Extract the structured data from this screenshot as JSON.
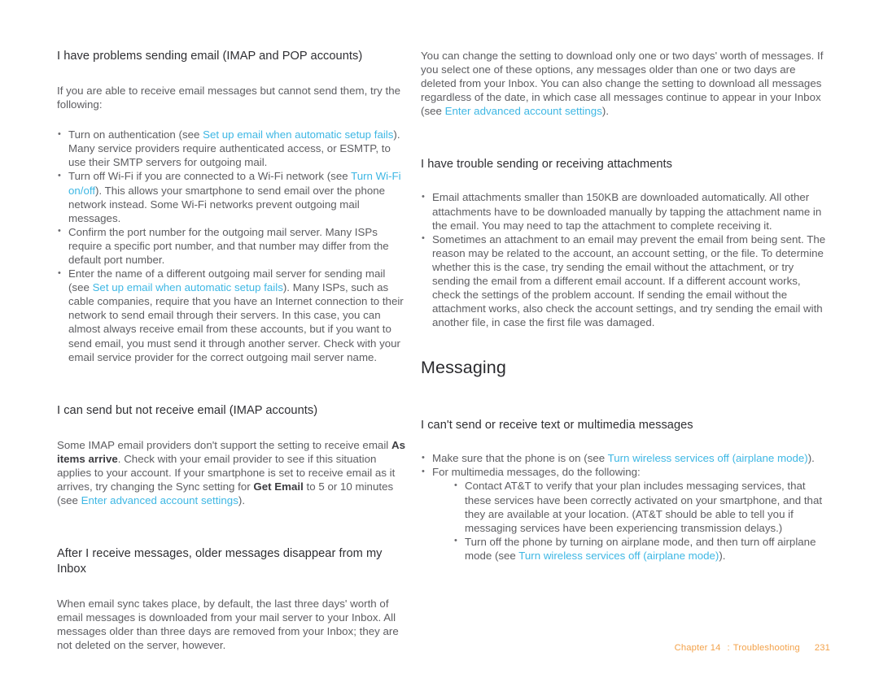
{
  "document": {
    "footer": {
      "chapter_label": "Chapter 14",
      "separator": ":",
      "chapter_title": "Troubleshooting",
      "page_number": "231",
      "color": "#f3a24a"
    },
    "link_color": "#3eb7e4",
    "body_color": "#5d5d61",
    "heading_color": "#2f2f33"
  },
  "left_column": {
    "topic1": {
      "title": "I have problems sending email (IMAP and POP accounts)",
      "intro": "If you are able to receive email messages but cannot send them, try the following:",
      "bullets": [
        {
          "part1": "Turn on authentication (see ",
          "link1": "Set up email when automatic setup fails",
          "part2": "). Many service providers require authenticated access, or ESMTP, to use their SMTP servers for outgoing mail."
        },
        {
          "part1": "Turn off Wi-Fi if you are connected to a Wi-Fi network (see ",
          "link1": "Turn Wi-Fi on/off",
          "part2": "). This allows your smartphone to send email over the phone network instead. Some Wi-Fi networks prevent outgoing mail messages."
        },
        {
          "part1": "Confirm the port number for the outgoing mail server. Many ISPs require a specific port number, and that number may differ from the default port number.",
          "link1": "",
          "part2": ""
        },
        {
          "part1": "Enter the name of a different outgoing mail server for sending mail (see ",
          "link1": "Set up email when automatic setup fails",
          "part2": "). Many ISPs, such as cable companies, require that you have an Internet connection to their network to send email through their servers. In this case, you can almost always receive email from these accounts, but if you want to send email, you must send it through another server. Check with your email service provider for the correct outgoing mail server name."
        }
      ]
    },
    "topic2": {
      "title": "I can send but not receive email (IMAP accounts)",
      "para": {
        "part1": "Some IMAP email providers don't support the setting to receive email ",
        "bold1": "As items arrive",
        "part2": ". Check with your email provider to see if this situation applies to your account. If your smartphone is set to receive email as it arrives, try changing the Sync setting for ",
        "bold2": "Get Email",
        "part3": " to 5 or 10 minutes (see ",
        "link1": "Enter advanced account settings",
        "part4": ")."
      }
    },
    "topic3": {
      "title": "After I receive messages, older messages disappear from my Inbox",
      "para": "When email sync takes place, by default, the last three days' worth of email messages is downloaded from your mail server to your Inbox. All messages older than three days are removed from your Inbox; they are not deleted on the server, however."
    }
  },
  "right_column": {
    "continuation": {
      "part1": "You can change the setting to download only one or two days' worth of messages. If you select one of these options, any messages older than one or two days are deleted from your Inbox. You can also change the setting to download all messages regardless of the date, in which case all messages continue to appear in your Inbox (see ",
      "link1": "Enter advanced account settings",
      "part2": ")."
    },
    "topic1": {
      "title": "I have trouble sending or receiving attachments",
      "bullets": [
        "Email attachments smaller than 150KB are downloaded automatically. All other attachments have to be downloaded manually by tapping the attachment name in the email. You may need to tap the attachment to complete receiving it.",
        "Sometimes an attachment to an email may prevent the email from being sent. The reason may be related to the account, an account setting, or the file. To determine whether this is the case, try sending the email without the attachment, or try sending the email from a different email account. If a different account works, check the settings of the problem account. If sending the email without the attachment works, also check the account settings, and try sending the email with another file, in case the first file was damaged."
      ]
    },
    "section_heading": "Messaging",
    "topic2": {
      "title": "I can't send or receive text or multimedia messages",
      "bullet1": {
        "part1": "Make sure that the phone is on (see ",
        "link1": "Turn wireless services off (airplane mode)",
        "part2": ")."
      },
      "bullet2": "For multimedia messages, do the following:",
      "subbullets": [
        {
          "part1": "Contact AT&T to verify that your plan includes messaging services, that these services have been correctly activated on your smartphone, and that they are available at your location. (AT&T should be able to tell you if messaging services have been experiencing transmission delays.)",
          "link1": "",
          "part2": ""
        },
        {
          "part1": "Turn off the phone by turning on airplane mode, and then turn off airplane mode (see ",
          "link1": "Turn wireless services off (airplane mode)",
          "part2": ")."
        }
      ]
    }
  }
}
